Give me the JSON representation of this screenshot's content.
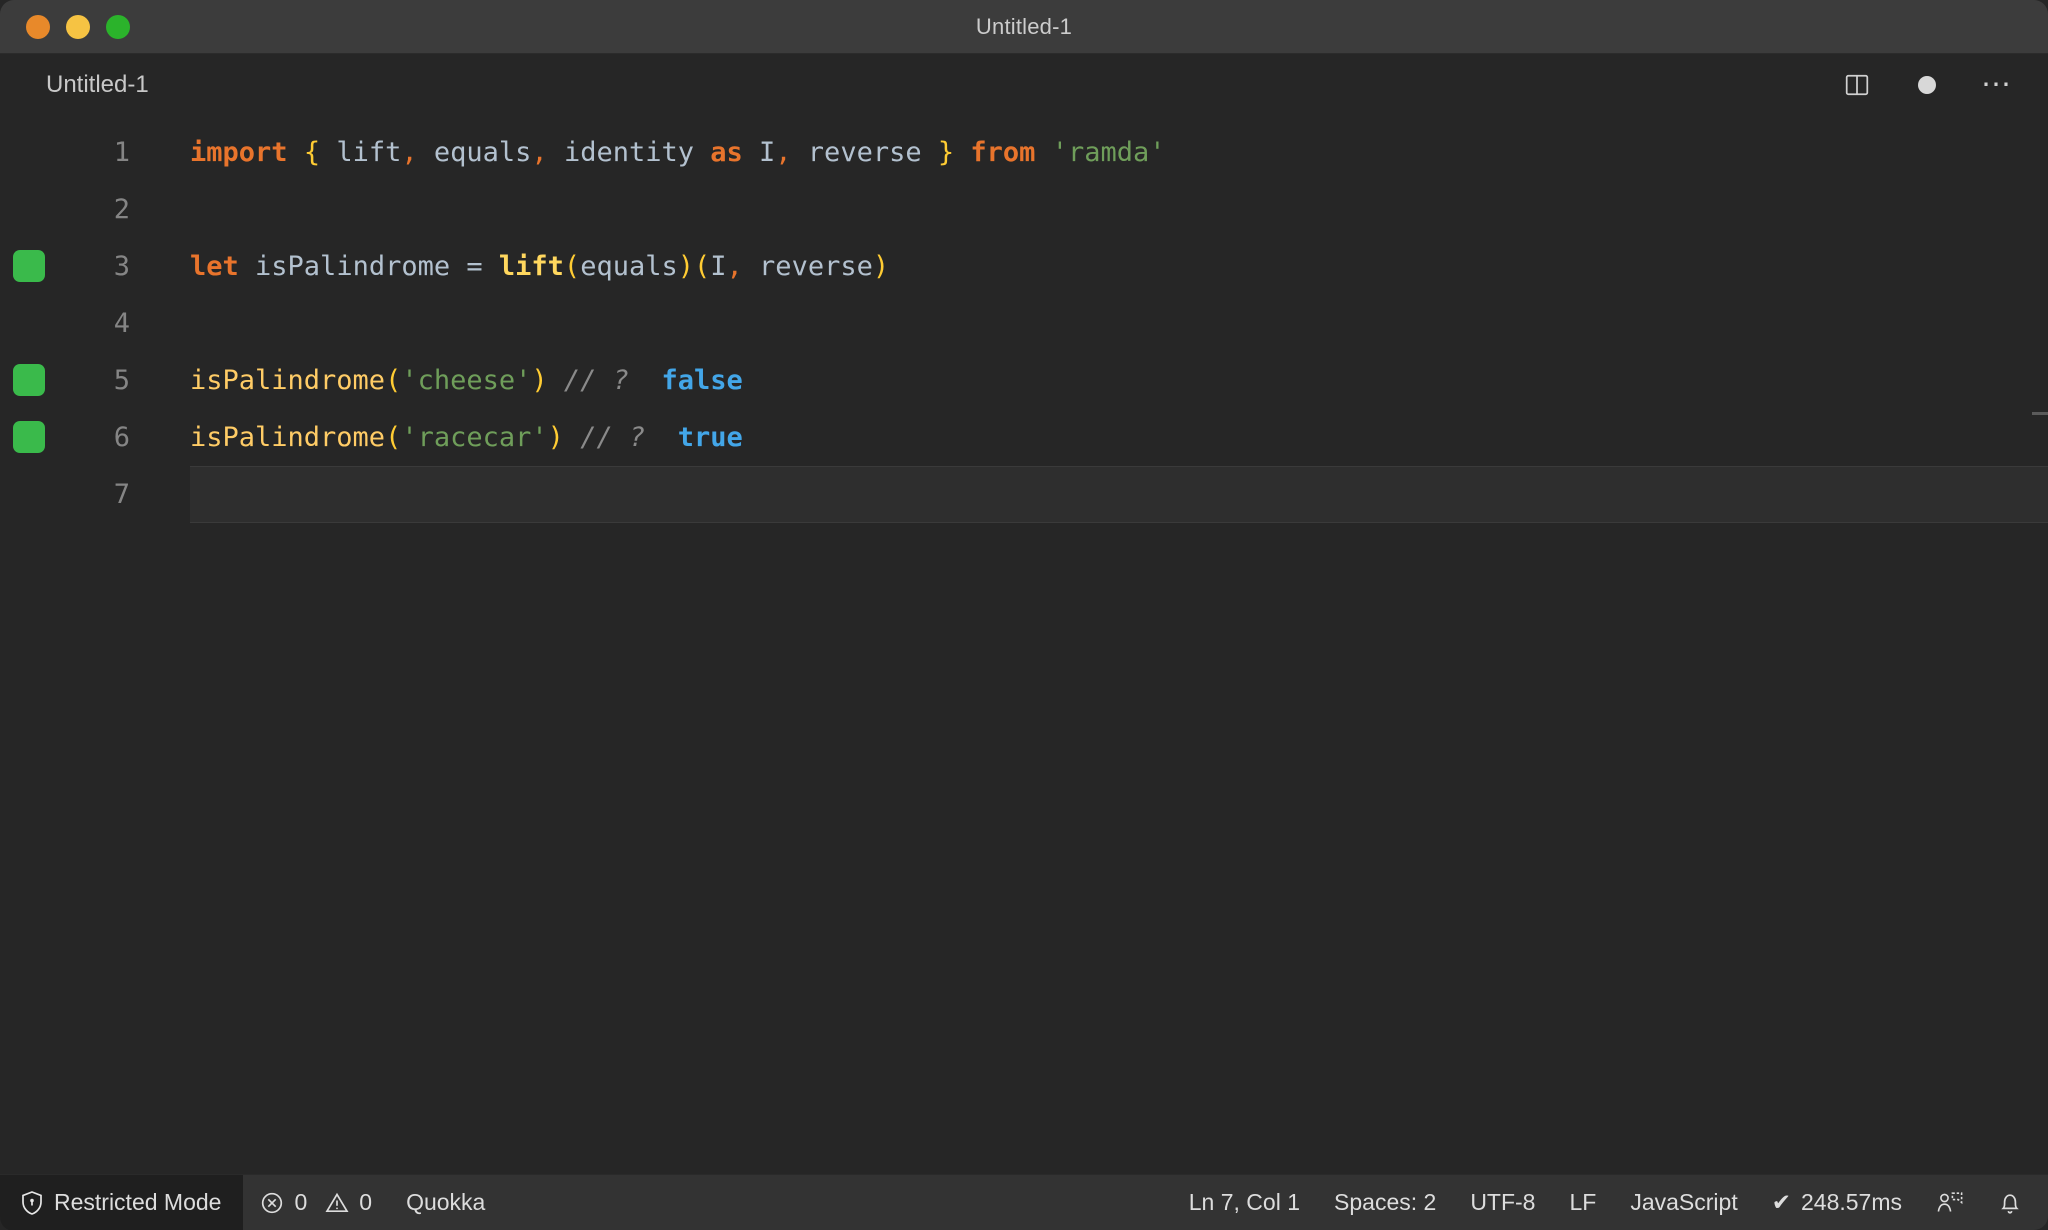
{
  "window": {
    "title": "Untitled-1",
    "traffic_lights": [
      {
        "name": "close",
        "color": "#e8892a"
      },
      {
        "name": "minimize",
        "color": "#f6c343"
      },
      {
        "name": "maximize",
        "color": "#2bb32b"
      }
    ]
  },
  "tab": {
    "label": "Untitled-1",
    "actions": [
      {
        "name": "split-editor-icon",
        "label": "Split Editor"
      },
      {
        "name": "unsaved-dot-icon",
        "label": "Unsaved changes"
      },
      {
        "name": "more-actions-icon",
        "label": "⋯"
      }
    ]
  },
  "editor": {
    "language": "JavaScript",
    "lines": [
      {
        "number": "1",
        "marked": false,
        "current": false,
        "tokens": [
          {
            "t": "import",
            "c": "t-key"
          },
          {
            "t": " ",
            "c": "t-plain"
          },
          {
            "t": "{",
            "c": "t-brace"
          },
          {
            "t": " lift",
            "c": "t-ident"
          },
          {
            "t": ",",
            "c": "t-punc"
          },
          {
            "t": " equals",
            "c": "t-ident"
          },
          {
            "t": ",",
            "c": "t-punc"
          },
          {
            "t": " identity ",
            "c": "t-ident"
          },
          {
            "t": "as",
            "c": "t-key"
          },
          {
            "t": " I",
            "c": "t-ident"
          },
          {
            "t": ",",
            "c": "t-punc"
          },
          {
            "t": " reverse ",
            "c": "t-ident"
          },
          {
            "t": "}",
            "c": "t-brace"
          },
          {
            "t": " ",
            "c": "t-plain"
          },
          {
            "t": "from",
            "c": "t-key"
          },
          {
            "t": " ",
            "c": "t-plain"
          },
          {
            "t": "'ramda'",
            "c": "t-string"
          }
        ]
      },
      {
        "number": "2",
        "marked": false,
        "current": false,
        "tokens": []
      },
      {
        "number": "3",
        "marked": true,
        "current": false,
        "tokens": [
          {
            "t": "let",
            "c": "t-key"
          },
          {
            "t": " isPalindrome ",
            "c": "t-ident"
          },
          {
            "t": "=",
            "c": "t-op"
          },
          {
            "t": " ",
            "c": "t-plain"
          },
          {
            "t": "lift",
            "c": "t-fnyellow"
          },
          {
            "t": "(",
            "c": "t-paren"
          },
          {
            "t": "equals",
            "c": "t-ident"
          },
          {
            "t": ")",
            "c": "t-paren"
          },
          {
            "t": "(",
            "c": "t-paren"
          },
          {
            "t": "I",
            "c": "t-ident"
          },
          {
            "t": ",",
            "c": "t-punc"
          },
          {
            "t": " reverse",
            "c": "t-ident"
          },
          {
            "t": ")",
            "c": "t-paren"
          }
        ]
      },
      {
        "number": "4",
        "marked": false,
        "current": false,
        "tokens": []
      },
      {
        "number": "5",
        "marked": true,
        "current": false,
        "tokens": [
          {
            "t": "isPalindrome",
            "c": "t-fncall"
          },
          {
            "t": "(",
            "c": "t-paren"
          },
          {
            "t": "'cheese'",
            "c": "t-string"
          },
          {
            "t": ")",
            "c": "t-paren"
          },
          {
            "t": " ",
            "c": "t-plain"
          },
          {
            "t": "// ?",
            "c": "t-comment"
          },
          {
            "t": "  ",
            "c": "t-plain"
          },
          {
            "t": "false",
            "c": "t-bool"
          }
        ]
      },
      {
        "number": "6",
        "marked": true,
        "current": false,
        "tokens": [
          {
            "t": "isPalindrome",
            "c": "t-fncall"
          },
          {
            "t": "(",
            "c": "t-paren"
          },
          {
            "t": "'racecar'",
            "c": "t-string"
          },
          {
            "t": ")",
            "c": "t-paren"
          },
          {
            "t": " ",
            "c": "t-plain"
          },
          {
            "t": "// ?",
            "c": "t-comment"
          },
          {
            "t": "  ",
            "c": "t-plain"
          },
          {
            "t": "true",
            "c": "t-bool"
          }
        ]
      },
      {
        "number": "7",
        "marked": false,
        "current": true,
        "tokens": []
      }
    ]
  },
  "statusbar": {
    "restricted_mode": "Restricted Mode",
    "errors": "0",
    "warnings": "0",
    "quokka": "Quokka",
    "cursor": "Ln 7, Col 1",
    "indentation": "Spaces: 2",
    "encoding": "UTF-8",
    "eol": "LF",
    "language": "JavaScript",
    "runtime": "248.57ms",
    "runtime_check": "✔",
    "icons": [
      {
        "name": "shield-icon"
      },
      {
        "name": "error-icon"
      },
      {
        "name": "warning-icon"
      },
      {
        "name": "feedback-icon"
      },
      {
        "name": "bell-icon"
      }
    ]
  },
  "colors": {
    "accent_green": "#3aba4b",
    "keyword_orange": "#e8742c",
    "string_green": "#6f9e5a",
    "function_yellow": "#ffd75e",
    "boolean_blue": "#43a6e8",
    "editor_bg": "#262626",
    "statusbar_bg": "#333333"
  }
}
